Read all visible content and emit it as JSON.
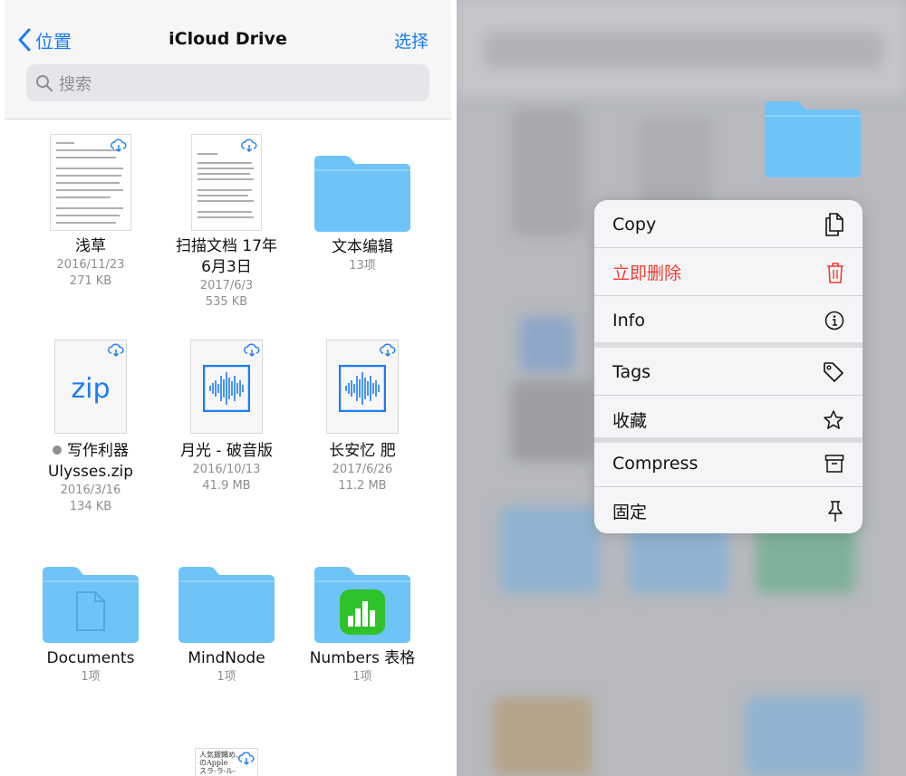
{
  "nav": {
    "back_label": "位置",
    "title": "iCloud Drive",
    "select_label": "选择"
  },
  "search": {
    "placeholder": "搜索"
  },
  "files": [
    {
      "name": "浅草",
      "date": "2016/11/23",
      "size": "271 KB",
      "icon": "document-thumbnail"
    },
    {
      "name": "扫描文档 17年",
      "name2": "6月3日",
      "date": "2017/6/3",
      "size": "535 KB",
      "icon": "scanned-document-thumbnail"
    },
    {
      "name": "文本编辑",
      "count": "13项",
      "icon": "folder-icon"
    },
    {
      "name": "写作利器",
      "name2": "Ulysses.zip",
      "date": "2016/3/16",
      "size": "134 KB",
      "icon": "zip-icon",
      "badge": "zip"
    },
    {
      "name": "月光 - 破音版",
      "date": "2016/10/13",
      "size": "41.9 MB",
      "icon": "audio-icon"
    },
    {
      "name": "长安忆 肥",
      "date": "2017/6/26",
      "size": "11.2 MB",
      "icon": "audio-icon"
    },
    {
      "name": "Documents",
      "count": "1项",
      "icon": "folder-icon"
    },
    {
      "name": "MindNode",
      "count": "1项",
      "icon": "folder-icon"
    },
    {
      "name": "Numbers 表格",
      "count": "1项",
      "icon": "numbers-folder-icon"
    }
  ],
  "partial_doc_text": [
    "人気銀鐵め、",
    "のApple",
    "スラ-ラ-ル-"
  ],
  "context_menu": [
    {
      "label": "Copy",
      "icon": "copy-icon"
    },
    {
      "label": "立即删除",
      "icon": "trash-icon"
    },
    {
      "label": "Info",
      "icon": "info-icon"
    },
    {
      "label": "Tags",
      "icon": "tag-icon"
    },
    {
      "label": "收藏",
      "icon": "star-icon"
    },
    {
      "label": "Compress",
      "icon": "archive-icon"
    },
    {
      "label": "固定",
      "icon": "pin-icon"
    }
  ],
  "colors": {
    "accent": "#1b7cf6",
    "folder": "#6ec3f7",
    "destructive": "#f23a2f",
    "numbers_green": "#2fc22a"
  }
}
